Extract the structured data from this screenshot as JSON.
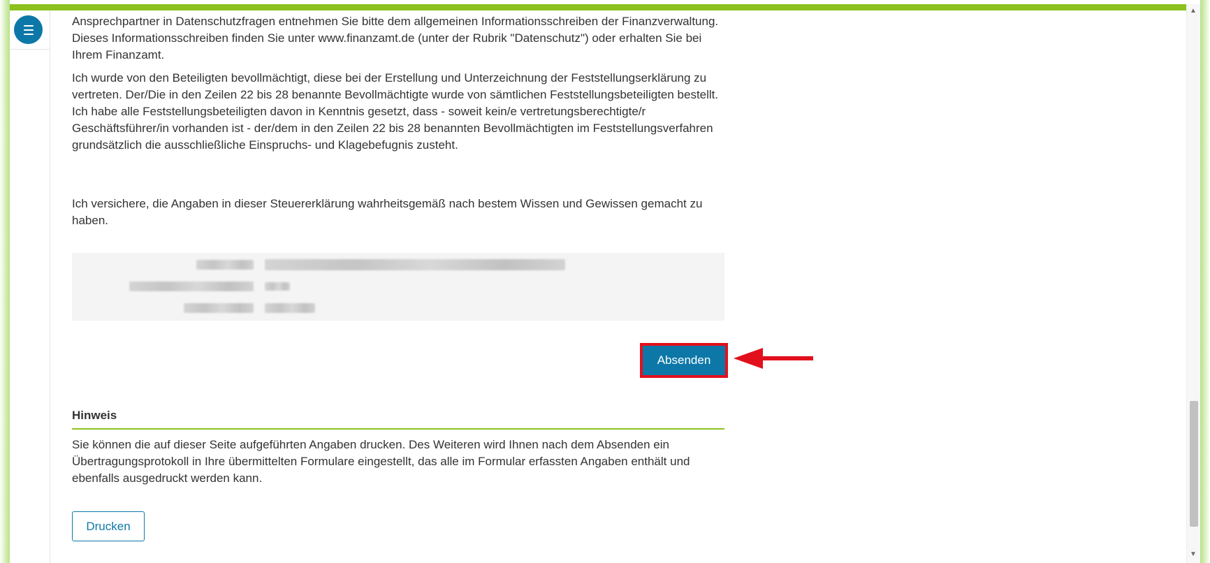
{
  "sidebar": {
    "menu_icon": "hamburger-menu-icon"
  },
  "content": {
    "paragraph_1": "Ansprechpartner in Datenschutzfragen entnehmen Sie bitte dem allgemeinen Informationsschreiben der Finanzverwaltung. Dieses Informationsschreiben finden Sie unter www.finanzamt.de (unter der Rubrik \"Datenschutz\") oder erhalten Sie bei Ihrem Finanzamt.",
    "paragraph_2": "Ich wurde von den Beteiligten bevollmächtigt, diese bei der Erstellung und Unterzeichnung der Feststellungserklärung zu vertreten. Der/Die in den Zeilen 22 bis 28 benannte Bevollmächtigte wurde von sämtlichen Feststellungsbeteiligten bestellt. Ich habe alle Feststellungsbeteiligten davon in Kenntnis gesetzt, dass - soweit kein/e vertretungsberechtigte/r Geschäftsführer/in vorhanden ist - der/dem in den Zeilen 22 bis 28 benannten Bevollmächtigten im Feststellungsverfahren grundsätzlich die ausschließliche Einspruchs- und Klagebefugnis zusteht.",
    "paragraph_3": "Ich versichere, die Angaben in dieser Steuererklärung wahrheitsgemäß nach bestem Wissen und Gewissen gemacht zu haben."
  },
  "actions": {
    "send_label": "Absenden",
    "highlight_color": "#e2101c",
    "arrow_color": "#e2101c"
  },
  "hint": {
    "title": "Hinweis",
    "text": "Sie können die auf dieser Seite aufgeführten Angaben drucken. Des Weiteren wird Ihnen nach dem Absenden ein Übertragungsprotokoll in Ihre übermittelten Formulare eingestellt, das alle im Formular erfassten Angaben enthält und ebenfalls ausgedruckt werden kann.",
    "print_label": "Drucken"
  },
  "colors": {
    "accent_green": "#8cc11f",
    "primary_blue": "#0d78a8",
    "text": "#333333"
  }
}
